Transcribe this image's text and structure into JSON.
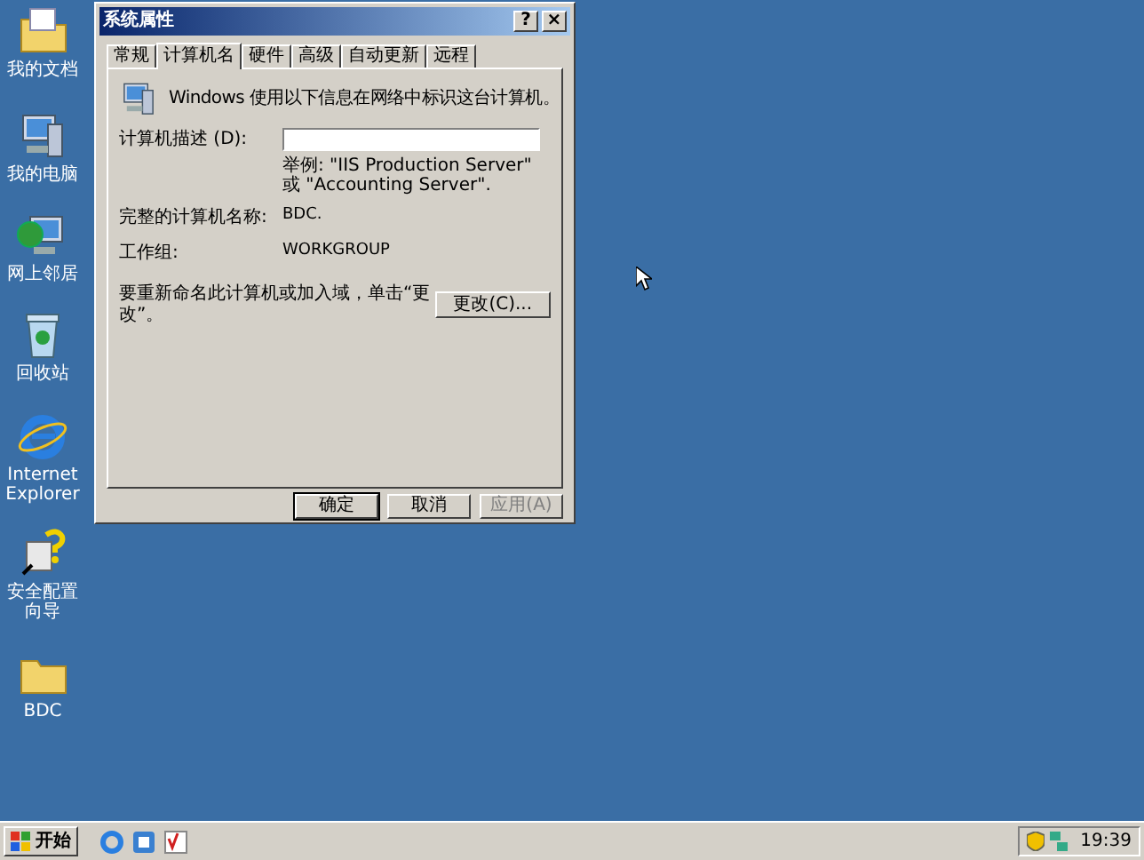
{
  "desktop_icons": [
    {
      "label": "我的文档",
      "kind": "folder-doc"
    },
    {
      "label": "我的电脑",
      "kind": "computer"
    },
    {
      "label": "网上邻居",
      "kind": "network"
    },
    {
      "label": "回收站",
      "kind": "recycle"
    },
    {
      "label": "Internet Explorer",
      "kind": "ie"
    },
    {
      "label": "安全配置向导",
      "kind": "wizard"
    },
    {
      "label": "BDC",
      "kind": "folder"
    }
  ],
  "dialog": {
    "title": "系统属性",
    "title_buttons": [
      "?",
      "×"
    ],
    "tabs": [
      {
        "label": "常规",
        "selected": false
      },
      {
        "label": "计算机名",
        "selected": true
      },
      {
        "label": "硬件",
        "selected": false
      },
      {
        "label": "高级",
        "selected": false
      },
      {
        "label": "自动更新",
        "selected": false
      },
      {
        "label": "远程",
        "selected": false
      }
    ],
    "intro": "Windows 使用以下信息在网络中标识这台计算机。",
    "description_label": "计算机描述 (D):",
    "description_hint": "举例: \"IIS Production Server\" 或 \"Accounting Server\".",
    "full_name_label": "完整的计算机名称:",
    "full_name": "BDC.",
    "workgroup_label": "工作组:",
    "workgroup": "WORKGROUP",
    "rename_text": "要重新命名此计算机或加入域，单击“更改”。",
    "change_button": "更改(C)...",
    "buttons": [
      {
        "label": "确定",
        "disabled": false
      },
      {
        "label": "取消",
        "disabled": false
      },
      {
        "label": "应用(A)",
        "disabled": true
      }
    ]
  },
  "taskbar": {
    "start": "开始",
    "clock": "19:39"
  }
}
